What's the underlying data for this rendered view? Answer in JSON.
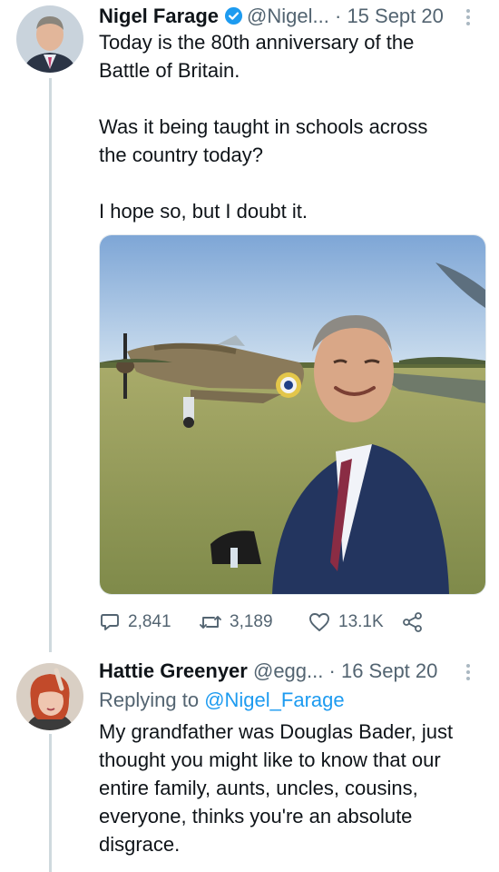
{
  "tweet1": {
    "name": "Nigel Farage",
    "handle": "@Nigel...",
    "separator": "·",
    "date": "15 Sept 20",
    "text": "Today is the 80th anniversary of the\nBattle of Britain.\n\nWas it being taught in schools across\nthe country today?\n\nI hope so, but I doubt it.",
    "actions": {
      "replies": "2,841",
      "retweets": "3,189",
      "likes": "13.1K"
    }
  },
  "tweet2": {
    "name": "Hattie Greenyer",
    "handle": "@egg...",
    "separator": "·",
    "date": "16 Sept 20",
    "reply_prefix": "Replying to ",
    "reply_to": "@Nigel_Farage",
    "text": "My grandfather was Douglas Bader, just\nthought you might like to know that our\nentire family, aunts, uncles, cousins,\neveryone, thinks you're an absolute\ndisgrace."
  },
  "icons": {
    "verified": "verified-badge-icon",
    "reply": "speech-bubble-icon",
    "retweet": "retweet-arrows-icon",
    "like": "heart-icon",
    "share": "share-icon",
    "more": "vertical-dots-icon"
  },
  "colors": {
    "text": "#0f1419",
    "secondary": "#536471",
    "link": "#1d9bf0",
    "verified": "#1d9bf0",
    "thread_line": "#cfd9de"
  }
}
